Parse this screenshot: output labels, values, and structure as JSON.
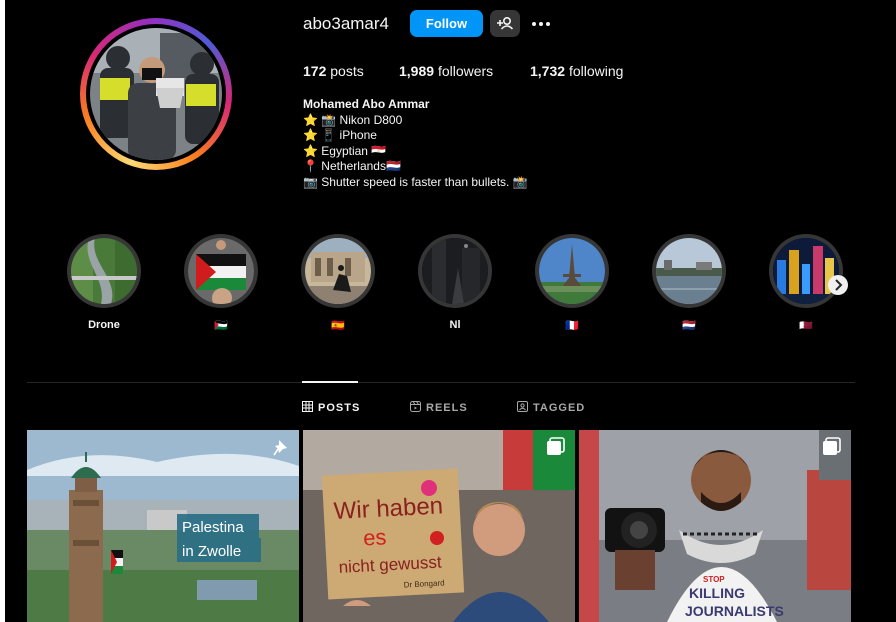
{
  "profile": {
    "username": "abo3amar4",
    "follow_label": "Follow",
    "stats": {
      "posts_count": "172",
      "posts_label": "posts",
      "followers_count": "1,989",
      "followers_label": "followers",
      "following_count": "1,732",
      "following_label": "following"
    },
    "bio": {
      "name": "Mohamed Abo Ammar",
      "lines": [
        "⭐ 📸 Nikon D800",
        "⭐ 📱 iPhone",
        "⭐ Egyptian 🇪🇬",
        "📍 Netherlands🇳🇱",
        "📷 Shutter speed is faster than bullets. 📸"
      ]
    }
  },
  "highlights": [
    {
      "label": "Drone"
    },
    {
      "label": "🇵🇸"
    },
    {
      "label": "🇪🇸"
    },
    {
      "label": "Nl"
    },
    {
      "label": "🇫🇷"
    },
    {
      "label": "🇳🇱"
    },
    {
      "label": "🇶🇦"
    }
  ],
  "tabs": [
    {
      "label": "POSTS",
      "icon": "grid-icon",
      "active": true
    },
    {
      "label": "REELS",
      "icon": "reels-icon",
      "active": false
    },
    {
      "label": "TAGGED",
      "icon": "tagged-icon",
      "active": false
    }
  ],
  "posts": [
    {
      "overlay_text_1": "Palestina",
      "overlay_text_2": "in Zwolle",
      "badge": "pin-icon"
    },
    {
      "sign_line_1": "Wir haben",
      "sign_line_2": "es",
      "sign_line_3": "nicht gewusst",
      "sign_signature": "Dr Bongard",
      "badge": "carousel-icon"
    },
    {
      "shirt_line_1": "STOP",
      "shirt_line_2": "KILLING",
      "shirt_line_3": "JOURNALISTS",
      "badge": "carousel-icon"
    }
  ],
  "colors": {
    "background": "#000000",
    "follow_button": "#0095f6",
    "secondary_button": "#363636",
    "text_primary": "#f5f5f5",
    "text_secondary": "#a8a8a8"
  }
}
